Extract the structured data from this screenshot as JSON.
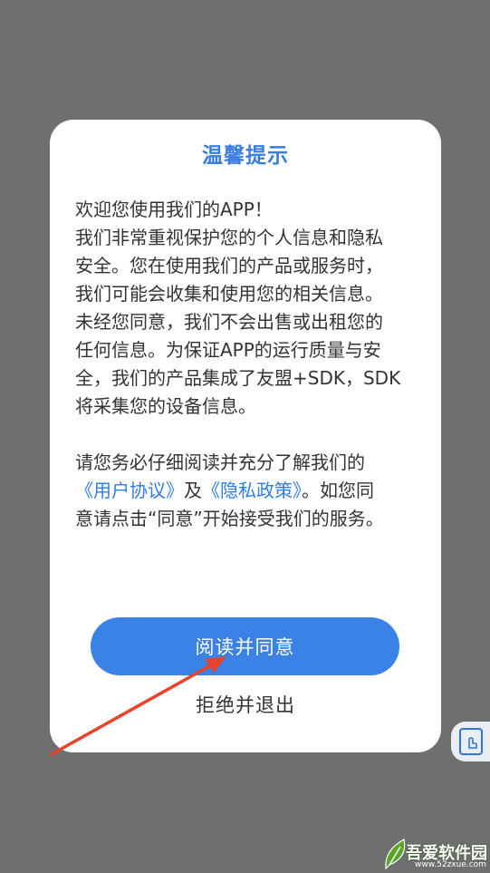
{
  "dialog": {
    "title": "温馨提示",
    "paragraph1": [
      "欢迎您使用我们的APP！",
      "我们非常重视保护您的个人信息和隐私",
      "安全。您在使用我们的产品或服务时，",
      "我们可能会收集和使用您的相关信息。",
      "未经您同意，我们不会出售或出租您的",
      "任何信息。为保证APP的运行质量与安",
      "全，我们的产品集成了友盟+SDK，SDK",
      "将采集您的设备信息。"
    ],
    "paragraph2_line1": "请您务必仔细阅读并充分了解我们的",
    "user_agreement_link": "《用户协议》",
    "and_text": "及",
    "privacy_policy_link": "《隐私政策》",
    "paragraph2_line2_rest": "。如您同",
    "paragraph2_line3": "意请点击“同意”开始接受我们的服务。",
    "agree_button": "阅读并同意",
    "reject_button": "拒绝并退出"
  },
  "watermark": {
    "brand": "吾爱软件园",
    "url": "www.52zxue.com"
  },
  "colors": {
    "accent": "#3b82e6",
    "link": "#2f7de6",
    "overlay": "#6f6f6f",
    "arrow": "#e8432a"
  },
  "icons": {
    "float_button": "assistant-touch-icon"
  }
}
